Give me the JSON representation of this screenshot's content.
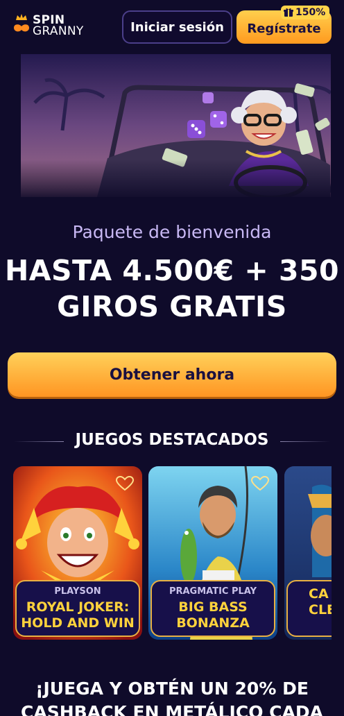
{
  "header": {
    "logo_line1": "SPIN",
    "logo_line2": "GRANNY",
    "login_label": "Iniciar sesión",
    "register_label": "Regístrate",
    "bonus_badge": "150%"
  },
  "hero": {
    "subtitle": "Paquete de bienvenida",
    "title_line1": "HASTA 4.500€ + 350",
    "title_line2": "GIROS GRATIS",
    "cta_label": "Obtener ahora"
  },
  "featured": {
    "title": "JUEGOS DESTACADOS",
    "games": [
      {
        "provider": "PLAYSON",
        "name_line1": "ROYAL JOKER:",
        "name_line2": "HOLD AND WIN"
      },
      {
        "provider": "PRAGMATIC PLAY",
        "name_line1": "BIG BASS",
        "name_line2": "BONANZA"
      },
      {
        "provider": "",
        "name_line1": "CA",
        "name_line2": "CLE"
      }
    ]
  },
  "cashback": {
    "line1": "¡JUEGA Y OBTÉN UN 20% DE",
    "line2": "CASHBACK EN METÁLICO CADA"
  },
  "colors": {
    "background": "#0f0b2a",
    "accent_orange": "#ff9a1f",
    "accent_yellow": "#ffd23c",
    "subtitle_lavender": "#c8b8f4"
  },
  "icons": [
    "spin-granny-logo-icon",
    "gift-icon",
    "heart-icon"
  ]
}
